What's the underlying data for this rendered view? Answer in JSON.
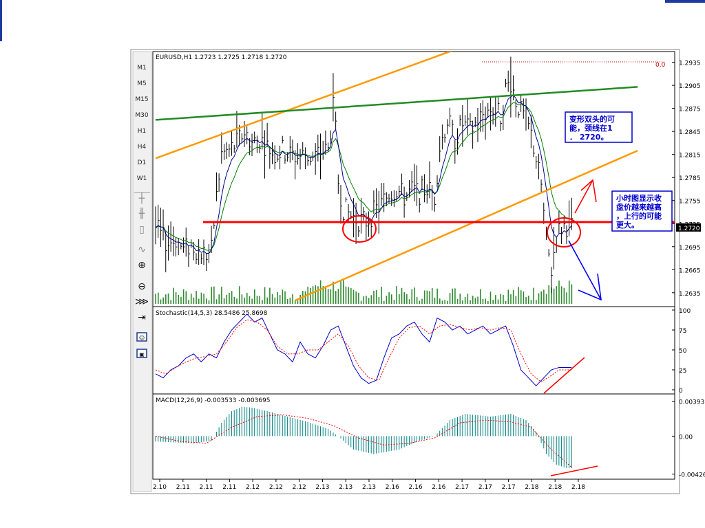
{
  "toolbar": {
    "timeframes": [
      "M1",
      "M5",
      "M15",
      "M30",
      "H1",
      "H4",
      "D1",
      "W1"
    ],
    "tools": [
      {
        "name": "crosshair-icon",
        "glyph": "┼"
      },
      {
        "name": "bar-chart-icon",
        "glyph": "╫"
      },
      {
        "name": "candlestick-icon",
        "glyph": "▯"
      },
      {
        "name": "line-chart-icon",
        "glyph": "∿"
      },
      {
        "name": "zoom-in-icon",
        "glyph": "⊕"
      },
      {
        "name": "zoom-out-icon",
        "glyph": "⊖"
      },
      {
        "name": "auto-scroll-icon",
        "glyph": "⋙"
      },
      {
        "name": "chart-shift-icon",
        "glyph": "⇥"
      },
      {
        "name": "expert-advisor-icon",
        "glyph": "☺"
      },
      {
        "name": "terminal-icon",
        "glyph": "▣"
      },
      {
        "name": "navigator-icon",
        "glyph": "▤"
      }
    ]
  },
  "colors": {
    "price_line": "#ff0000",
    "bars": "#000000",
    "ma_fast": "#00008b",
    "ma_slow": "#008000",
    "volume": "#2e8b2e",
    "channel": "#ff9900",
    "trendline_green": "#228b22",
    "stoch_main": "#0000cc",
    "stoch_signal": "#ff0000",
    "macd_hist": "#008080",
    "macd_signal": "#ff0000",
    "annotation_text": "#0000cc"
  },
  "chart_data": [
    {
      "type": "candlestick",
      "header": "EURUSD,H1  1.2723 1.2725 1.2718 1.2720",
      "ylim": [
        1.2625,
        1.294
      ],
      "y_ticks": [
        "1.2935",
        "1.2905",
        "1.2875",
        "1.2845",
        "1.2815",
        "1.2785",
        "1.2755",
        "1.2725",
        "1.2695",
        "1.2665",
        "1.2635"
      ],
      "current_price": "1.2720",
      "price_level": 1.2727,
      "top_right_label": "0.0",
      "x_ticks": [
        "2.10",
        "2.11",
        "2.11",
        "2.11",
        "2.12",
        "2.12",
        "2.12",
        "2.13",
        "2.13",
        "2.13",
        "2.16",
        "2.16",
        "2.16",
        "2.17",
        "2.17",
        "2.17",
        "2.18",
        "2.18",
        "2.18"
      ],
      "close_path": [
        [
          0,
          1.272
        ],
        [
          3,
          1.2705
        ],
        [
          5,
          1.27
        ],
        [
          8,
          1.2705
        ],
        [
          11,
          1.269
        ],
        [
          14,
          1.2698
        ],
        [
          17,
          1.269
        ],
        [
          20,
          1.2685
        ],
        [
          22,
          1.269
        ],
        [
          24,
          1.276
        ],
        [
          26,
          1.2815
        ],
        [
          29,
          1.282
        ],
        [
          32,
          1.283
        ],
        [
          35,
          1.2845
        ],
        [
          38,
          1.283
        ],
        [
          41,
          1.2835
        ],
        [
          44,
          1.2825
        ],
        [
          47,
          1.2815
        ],
        [
          50,
          1.282
        ],
        [
          53,
          1.2815
        ],
        [
          56,
          1.2812
        ],
        [
          59,
          1.2815
        ],
        [
          62,
          1.281
        ],
        [
          65,
          1.2818
        ],
        [
          68,
          1.282
        ],
        [
          70,
          1.2875
        ],
        [
          71,
          1.2845
        ],
        [
          72,
          1.278
        ],
        [
          74,
          1.2745
        ],
        [
          77,
          1.2735
        ],
        [
          80,
          1.273
        ],
        [
          83,
          1.2728
        ],
        [
          86,
          1.274
        ],
        [
          89,
          1.275
        ],
        [
          92,
          1.2765
        ],
        [
          95,
          1.277
        ],
        [
          98,
          1.276
        ],
        [
          101,
          1.2768
        ],
        [
          104,
          1.2765
        ],
        [
          107,
          1.2772
        ],
        [
          110,
          1.276
        ],
        [
          112,
          1.2825
        ],
        [
          115,
          1.286
        ],
        [
          118,
          1.2835
        ],
        [
          121,
          1.2855
        ],
        [
          124,
          1.2845
        ],
        [
          127,
          1.286
        ],
        [
          130,
          1.287
        ],
        [
          133,
          1.2875
        ],
        [
          136,
          1.2865
        ],
        [
          138,
          1.29
        ],
        [
          140,
          1.291
        ],
        [
          142,
          1.2885
        ],
        [
          144,
          1.287
        ],
        [
          146,
          1.286
        ],
        [
          148,
          1.284
        ],
        [
          150,
          1.281
        ],
        [
          152,
          1.2775
        ],
        [
          154,
          1.27
        ],
        [
          156,
          1.2665
        ],
        [
          158,
          1.271
        ],
        [
          160,
          1.272
        ],
        [
          162,
          1.2723
        ],
        [
          164,
          1.272
        ]
      ],
      "overlay_lines": [
        {
          "name": "channel-upper",
          "points": [
            [
              0,
              1.281
            ],
            [
              121,
              1.2955
            ]
          ]
        },
        {
          "name": "channel-lower",
          "points": [
            [
              55,
              1.2625
            ],
            [
              190,
              1.282
            ]
          ]
        },
        {
          "name": "green-trendline",
          "points": [
            [
              0,
              1.286
            ],
            [
              190,
              1.2903
            ]
          ]
        }
      ],
      "annotations": [
        {
          "name": "annotation-double-top",
          "lines": [
            "变形双头的可",
            "能，颈线在1",
            "． 2720。"
          ]
        },
        {
          "name": "annotation-hourly-close",
          "lines": [
            "小时图显示收",
            "盘价越来越高",
            "，上行的可能",
            "更大。"
          ]
        }
      ]
    },
    {
      "type": "line",
      "header": "Stochastic(14,5,3)  28.5486  25.8698",
      "ylim": [
        0,
        100
      ],
      "y_ticks": [
        "100",
        "75",
        "50",
        "25",
        "0"
      ],
      "series": [
        {
          "key": "main",
          "values": [
            [
              0,
              20
            ],
            [
              3,
              15
            ],
            [
              6,
              25
            ],
            [
              9,
              30
            ],
            [
              12,
              40
            ],
            [
              15,
              45
            ],
            [
              18,
              35
            ],
            [
              21,
              45
            ],
            [
              24,
              40
            ],
            [
              27,
              60
            ],
            [
              30,
              75
            ],
            [
              33,
              85
            ],
            [
              36,
              95
            ],
            [
              39,
              85
            ],
            [
              42,
              90
            ],
            [
              45,
              70
            ],
            [
              48,
              50
            ],
            [
              51,
              45
            ],
            [
              54,
              35
            ],
            [
              57,
              60
            ],
            [
              60,
              45
            ],
            [
              63,
              40
            ],
            [
              66,
              55
            ],
            [
              69,
              75
            ],
            [
              72,
              80
            ],
            [
              75,
              55
            ],
            [
              78,
              30
            ],
            [
              81,
              15
            ],
            [
              84,
              8
            ],
            [
              87,
              12
            ],
            [
              90,
              40
            ],
            [
              93,
              65
            ],
            [
              96,
              70
            ],
            [
              99,
              80
            ],
            [
              102,
              85
            ],
            [
              105,
              70
            ],
            [
              108,
              60
            ],
            [
              111,
              90
            ],
            [
              114,
              85
            ],
            [
              117,
              75
            ],
            [
              120,
              80
            ],
            [
              123,
              70
            ],
            [
              126,
              75
            ],
            [
              129,
              80
            ],
            [
              132,
              70
            ],
            [
              135,
              75
            ],
            [
              138,
              80
            ],
            [
              141,
              55
            ],
            [
              144,
              25
            ],
            [
              147,
              15
            ],
            [
              150,
              5
            ],
            [
              153,
              15
            ],
            [
              156,
              25
            ],
            [
              159,
              28
            ]
          ]
        },
        {
          "key": "signal",
          "values": [
            [
              0,
              25
            ],
            [
              4,
              20
            ],
            [
              8,
              28
            ],
            [
              12,
              35
            ],
            [
              16,
              40
            ],
            [
              20,
              42
            ],
            [
              24,
              45
            ],
            [
              28,
              60
            ],
            [
              32,
              78
            ],
            [
              36,
              88
            ],
            [
              40,
              85
            ],
            [
              44,
              75
            ],
            [
              48,
              55
            ],
            [
              52,
              45
            ],
            [
              56,
              45
            ],
            [
              60,
              50
            ],
            [
              64,
              50
            ],
            [
              68,
              60
            ],
            [
              72,
              70
            ],
            [
              76,
              55
            ],
            [
              80,
              30
            ],
            [
              84,
              15
            ],
            [
              88,
              12
            ],
            [
              92,
              40
            ],
            [
              96,
              65
            ],
            [
              100,
              78
            ],
            [
              104,
              80
            ],
            [
              108,
              70
            ],
            [
              112,
              80
            ],
            [
              116,
              82
            ],
            [
              120,
              78
            ],
            [
              124,
              75
            ],
            [
              128,
              78
            ],
            [
              132,
              75
            ],
            [
              136,
              78
            ],
            [
              140,
              75
            ],
            [
              144,
              45
            ],
            [
              148,
              20
            ],
            [
              152,
              10
            ],
            [
              156,
              18
            ],
            [
              159,
              25
            ]
          ]
        }
      ]
    },
    {
      "type": "bar",
      "header": "MACD(12,26,9)  -0.003533  -0.003695",
      "ylim": [
        -0.0046,
        0.0042
      ],
      "y_ticks": [
        "0.00393",
        "0.00",
        "-0.00426"
      ],
      "histogram_points": [
        [
          0,
          -0.0006
        ],
        [
          15,
          -0.0008
        ],
        [
          22,
          -0.0005
        ],
        [
          26,
          0.0015
        ],
        [
          30,
          0.0028
        ],
        [
          34,
          0.0033
        ],
        [
          38,
          0.0032
        ],
        [
          44,
          0.0028
        ],
        [
          52,
          0.0022
        ],
        [
          60,
          0.0016
        ],
        [
          68,
          0.0008
        ],
        [
          72,
          0.0
        ],
        [
          78,
          -0.0015
        ],
        [
          86,
          -0.002
        ],
        [
          96,
          -0.0015
        ],
        [
          104,
          -0.0005
        ],
        [
          110,
          0.0
        ],
        [
          116,
          0.0018
        ],
        [
          122,
          0.0025
        ],
        [
          132,
          0.0022
        ],
        [
          140,
          0.0025
        ],
        [
          146,
          0.0018
        ],
        [
          150,
          0.0005
        ],
        [
          154,
          -0.002
        ],
        [
          158,
          -0.0032
        ],
        [
          162,
          -0.0036
        ]
      ],
      "signal_points": [
        [
          0,
          0.0
        ],
        [
          10,
          -0.0006
        ],
        [
          20,
          -0.0008
        ],
        [
          30,
          0.001
        ],
        [
          40,
          0.0022
        ],
        [
          50,
          0.0024
        ],
        [
          60,
          0.002
        ],
        [
          70,
          0.0012
        ],
        [
          80,
          -0.0002
        ],
        [
          90,
          -0.001
        ],
        [
          100,
          -0.0008
        ],
        [
          110,
          -0.0002
        ],
        [
          120,
          0.0015
        ],
        [
          130,
          0.0018
        ],
        [
          140,
          0.0016
        ],
        [
          148,
          0.001
        ],
        [
          156,
          -0.0015
        ],
        [
          164,
          -0.0035
        ]
      ]
    }
  ]
}
